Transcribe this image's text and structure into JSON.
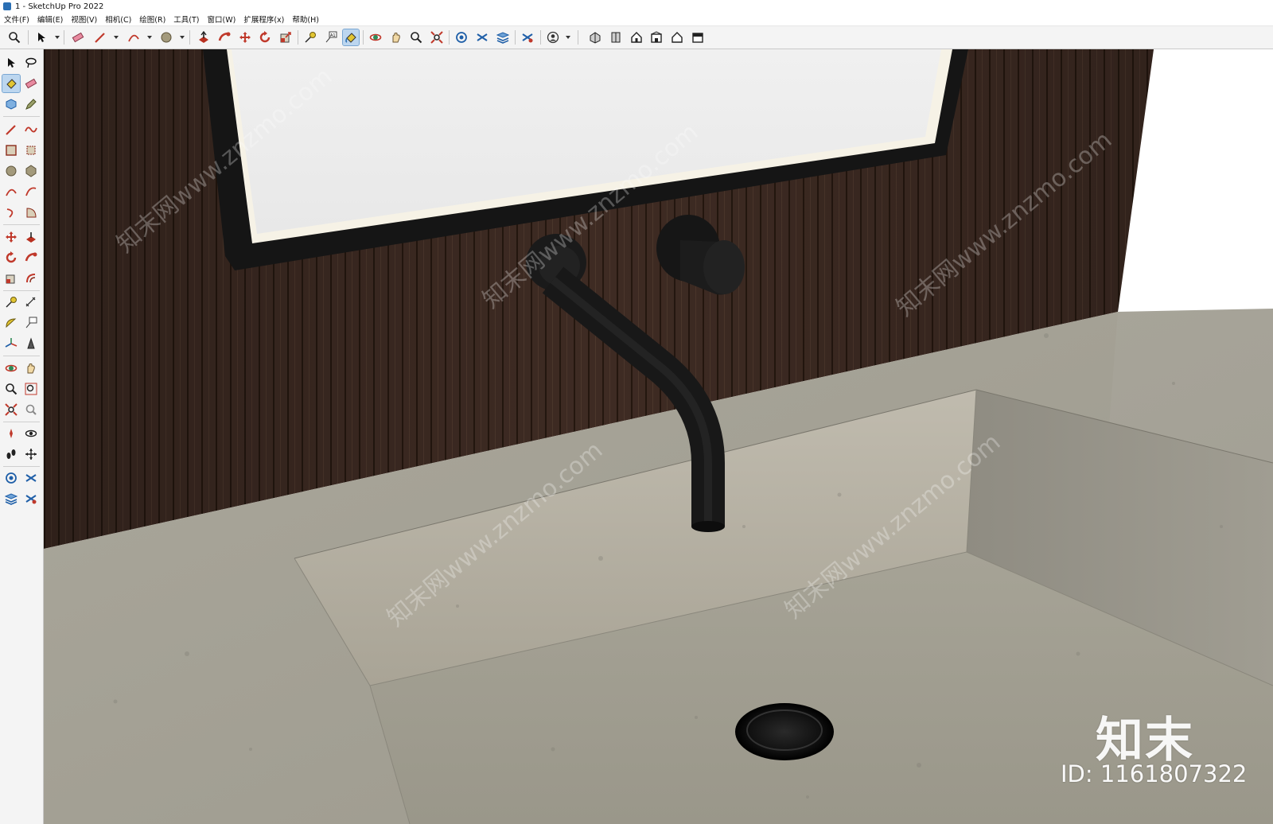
{
  "window": {
    "title": "1 - SketchUp Pro 2022"
  },
  "menu": [
    "文件(F)",
    "编辑(E)",
    "视图(V)",
    "相机(C)",
    "绘图(R)",
    "工具(T)",
    "窗口(W)",
    "扩展程序(x)",
    "帮助(H)"
  ],
  "toolbar": {
    "tools": [
      "zoom",
      "select",
      "eraser",
      "line",
      "arc",
      "circle",
      "push-pull",
      "follow-me",
      "move",
      "rotate",
      "scale",
      "tape-measure",
      "text",
      "paint-bucket",
      "orbit",
      "pan",
      "zoom",
      "zoom-extents",
      "section",
      "layers",
      "tags",
      "styles",
      "user",
      "house-iso",
      "house-front",
      "house-top",
      "house-right",
      "house-back",
      "house-left"
    ],
    "active": "paint-bucket"
  },
  "palette": {
    "active": "paint-bucket"
  },
  "scene": {
    "colors": {
      "wall": "#3d2a22",
      "stone": "#a9a79c",
      "stone_dark": "#8f8c82",
      "fixture": "#161616",
      "mirror": "#ececec"
    }
  },
  "overlay": {
    "brand": "知末",
    "id": "ID: 1161807322",
    "watermark": "知末网www.znzmo.com"
  }
}
